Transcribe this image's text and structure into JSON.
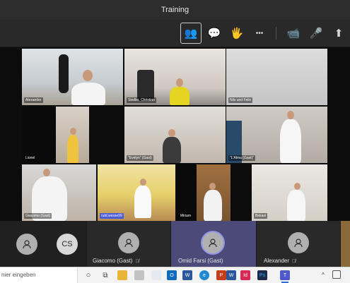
{
  "window": {
    "title": "Training"
  },
  "toolbar": {
    "buttons": [
      {
        "name": "participants-icon",
        "glyph": "👥",
        "active": true
      },
      {
        "name": "chat-icon",
        "glyph": "💬"
      },
      {
        "name": "reactions-icon",
        "glyph": "🖐"
      },
      {
        "name": "more-icon",
        "glyph": "•••"
      },
      {
        "name": "camera-icon",
        "glyph": "📹"
      },
      {
        "name": "microphone-icon",
        "glyph": "🎤"
      },
      {
        "name": "share-icon",
        "glyph": "⬆"
      }
    ]
  },
  "gallery": {
    "tiles": [
      {
        "label": "Alexander"
      },
      {
        "label": "Siedler, Christian"
      },
      {
        "label": "Nils und Felix"
      },
      {
        "label": "Lionel"
      },
      {
        "label": "\"Evelyn\" (Gast)"
      },
      {
        "label": "\"L'Alma (Gast)\""
      },
      {
        "label": "Giacomo (Gast)"
      },
      {
        "label": "rutd.wesse99"
      },
      {
        "label": "Miriam"
      },
      {
        "label": "Bekasi"
      }
    ]
  },
  "participants": [
    {
      "initials": "",
      "name": ""
    },
    {
      "initials": "CS",
      "name": ""
    },
    {
      "initials": "",
      "name": "Giacomo (Gast)"
    },
    {
      "initials": "",
      "name": "Omid Farsi (Gast)"
    },
    {
      "initials": "",
      "name": "Alexander"
    }
  ],
  "taskbar": {
    "search_placeholder": "nier eingeben",
    "apps": [
      {
        "name": "cortana-icon",
        "color": "#444",
        "glyph": "○"
      },
      {
        "name": "task-view-icon",
        "color": "#555",
        "glyph": "⧉"
      },
      {
        "name": "file-explorer-icon",
        "color": "#e8b53a",
        "glyph": ""
      },
      {
        "name": "outlook-icon",
        "color": "#0f6cbd",
        "glyph": "O"
      },
      {
        "name": "word-icon",
        "color": "#2b579a",
        "glyph": "W"
      },
      {
        "name": "edge-icon",
        "color": "#1f8ad2",
        "glyph": "e"
      },
      {
        "name": "powerpoint-icon",
        "color": "#c43e1c",
        "glyph": "P"
      },
      {
        "name": "word-icon-2",
        "color": "#2b579a",
        "glyph": "W"
      },
      {
        "name": "indesign-icon",
        "color": "#d62a55",
        "glyph": "Id"
      },
      {
        "name": "photoshop-icon",
        "color": "#1c2c4a",
        "glyph": "Ps"
      },
      {
        "name": "teams-icon",
        "color": "#5059c9",
        "glyph": "T"
      }
    ]
  }
}
